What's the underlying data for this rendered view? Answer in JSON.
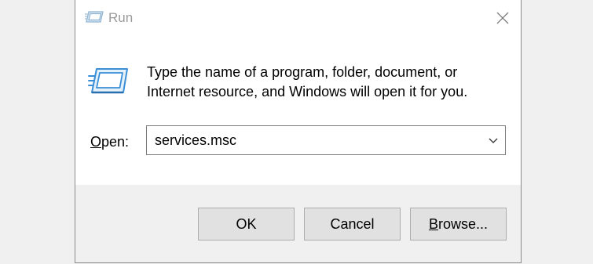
{
  "window": {
    "title": "Run",
    "title_icon": "run-icon",
    "close_icon": "close-icon"
  },
  "content": {
    "description_line1": "Type the name of a program, folder, document, or",
    "description_line2": "Internet resource, and Windows will open it for you.",
    "icon": "run-icon"
  },
  "open_field": {
    "label_mnemonic": "O",
    "label_rest": "pen:",
    "value": "services.msc",
    "dropdown_icon": "chevron-down-icon"
  },
  "buttons": {
    "ok": "OK",
    "cancel": "Cancel",
    "browse_mnemonic": "B",
    "browse_rest": "rowse..."
  },
  "colors": {
    "title_text": "#9a9a9a",
    "footer_bg": "#f0f0f0",
    "button_bg": "#e1e1e1",
    "button_border": "#adadad",
    "icon_blue": "#3a8fd6"
  }
}
